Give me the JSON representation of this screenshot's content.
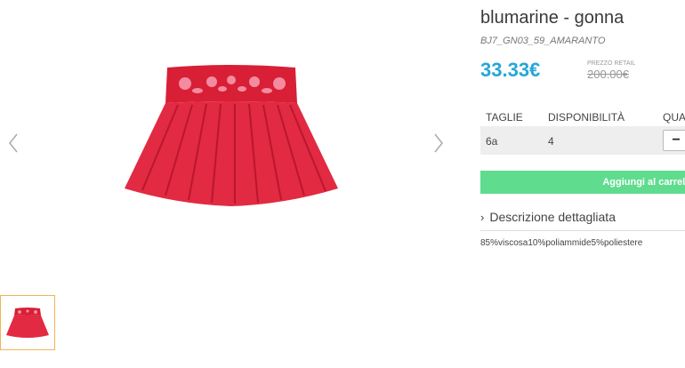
{
  "product": {
    "title": "blumarine - gonna",
    "sku": "BJ7_GN03_59_AMARANTO",
    "price": "33.33€",
    "retail_label": "PREZZO RETAIL",
    "retail_price": "200.00€"
  },
  "gallery": {
    "main_image_icon": "red-skirt-image",
    "prev_icon": "chevron-left-icon",
    "next_icon": "chevron-right-icon",
    "thumbnail_icon": "red-skirt-thumbnail"
  },
  "sizes_table": {
    "headers": [
      "TAGLIE",
      "DISPONIBILITÀ",
      "QUA"
    ],
    "rows": [
      {
        "size": "6a",
        "availability": "4",
        "qty_button": "−"
      }
    ]
  },
  "cart": {
    "add_label": "Aggiungi al carrello"
  },
  "description": {
    "toggle_label": "Descrizione dettagliata",
    "text": "85%viscosa10%poliammide5%poliestere"
  },
  "colors": {
    "price": "#27a6d8",
    "cart": "#5fdc8e",
    "thumb_border": "#f0b557",
    "skirt": "#d81f35"
  }
}
